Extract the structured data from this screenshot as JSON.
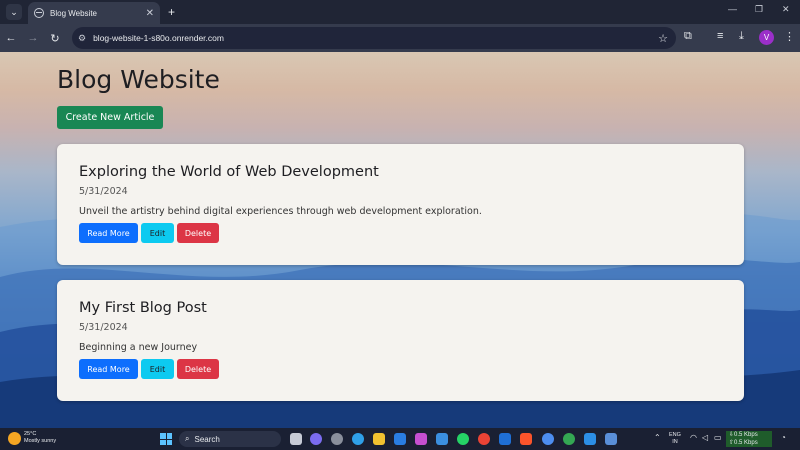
{
  "browser": {
    "tab_title": "Blog Website",
    "url": "blog-website-1-s80o.onrender.com",
    "avatar_letter": "V"
  },
  "page": {
    "title": "Blog Website",
    "create_button": "Create New Article"
  },
  "articles": [
    {
      "title": "Exploring the World of Web Development",
      "date": "5/31/2024",
      "description": "Unveil the artistry behind digital experiences through web development exploration.",
      "read_more": "Read More",
      "edit": "Edit",
      "delete": "Delete"
    },
    {
      "title": "My First Blog Post",
      "date": "5/31/2024",
      "description": "Beginning a new Journey",
      "read_more": "Read More",
      "edit": "Edit",
      "delete": "Delete"
    }
  ],
  "taskbar": {
    "weather_temp": "25°C",
    "weather_desc": "Mostly sunny",
    "search_label": "Search",
    "lang_1": "ENG",
    "lang_2": "IN",
    "net_down": "⇩0.5 Kbps",
    "net_up": "⇧0.5 Kbps"
  },
  "colors": {
    "create": "#198754",
    "read_more": "#0d6efd",
    "edit": "#0dcaf0",
    "delete": "#dc3545"
  }
}
